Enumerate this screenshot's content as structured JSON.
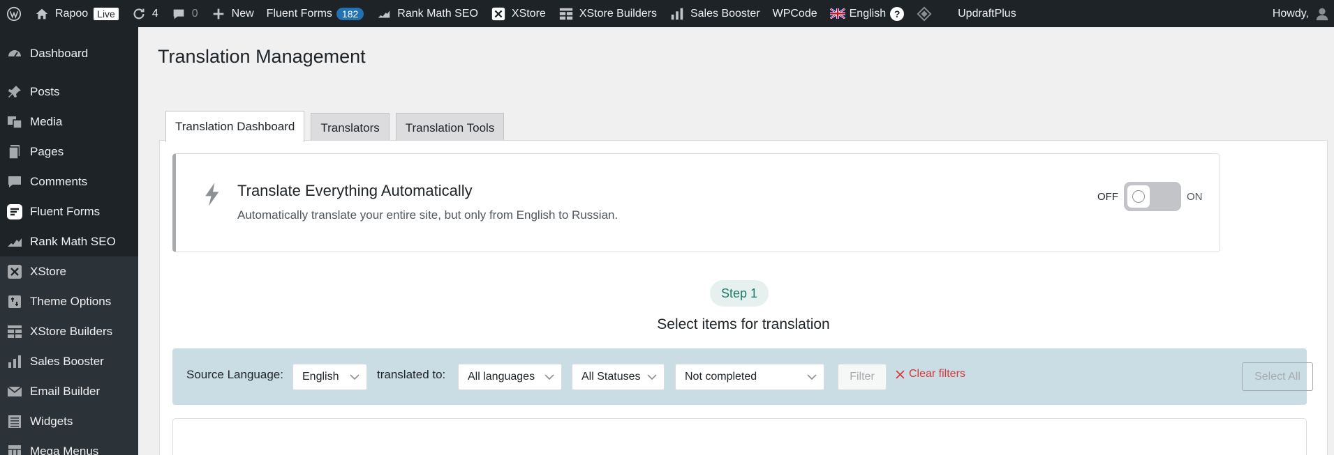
{
  "adminbar": {
    "site_name": "Rapoo",
    "live_badge": "Live",
    "updates_count": "4",
    "comments_count": "0",
    "new_label": "New",
    "fluent_forms": "Fluent Forms",
    "fluent_forms_count": "182",
    "rank_math": "Rank Math SEO",
    "xstore": "XStore",
    "xstore_builders": "XStore Builders",
    "sales_booster": "Sales Booster",
    "wpcode": "WPCode",
    "language": "English",
    "help": "?",
    "updraft": "UpdraftPlus",
    "howdy": "Howdy,"
  },
  "sidebar": {
    "items": [
      {
        "label": "Dashboard",
        "icon": "dashboard-icon"
      },
      {
        "label": "Posts",
        "icon": "pin-icon"
      },
      {
        "label": "Media",
        "icon": "media-icon"
      },
      {
        "label": "Pages",
        "icon": "pages-icon"
      },
      {
        "label": "Comments",
        "icon": "comment-icon"
      },
      {
        "label": "Fluent Forms",
        "icon": "fluent-forms-icon"
      },
      {
        "label": "Rank Math SEO",
        "icon": "rank-math-icon"
      },
      {
        "label": "XStore",
        "icon": "xstore-icon"
      },
      {
        "label": "Theme Options",
        "icon": "theme-options-icon"
      },
      {
        "label": "XStore Builders",
        "icon": "builders-icon"
      },
      {
        "label": "Sales Booster",
        "icon": "bar-chart-icon"
      },
      {
        "label": "Email Builder",
        "icon": "envelope-icon"
      },
      {
        "label": "Widgets",
        "icon": "widgets-icon"
      },
      {
        "label": "Mega Menus",
        "icon": "mega-menu-icon"
      }
    ]
  },
  "page": {
    "title": "Translation Management",
    "tabs": [
      {
        "label": "Translation Dashboard",
        "active": true
      },
      {
        "label": "Translators",
        "active": false
      },
      {
        "label": "Translation Tools",
        "active": false
      }
    ]
  },
  "auto_translate": {
    "title": "Translate Everything Automatically",
    "description": "Automatically translate your entire site, but only from English to Russian.",
    "off_label": "OFF",
    "on_label": "ON",
    "enabled": false
  },
  "step": {
    "pill": "Step 1",
    "title": "Select items for translation"
  },
  "filters": {
    "source_label": "Source Language:",
    "source_value": "English",
    "translated_label": "translated to:",
    "target_value": "All languages",
    "status_value": "All Statuses",
    "completion_value": "Not completed",
    "filter_button": "Filter",
    "clear_filters": "Clear filters",
    "select_all": "Select All"
  },
  "colors": {
    "adminbar_bg": "#1d2327",
    "accent_blue": "#2271b1",
    "filter_bar_bg": "#cbdde4",
    "step_green": "#1e7a6a",
    "clear_red": "#d63638"
  }
}
